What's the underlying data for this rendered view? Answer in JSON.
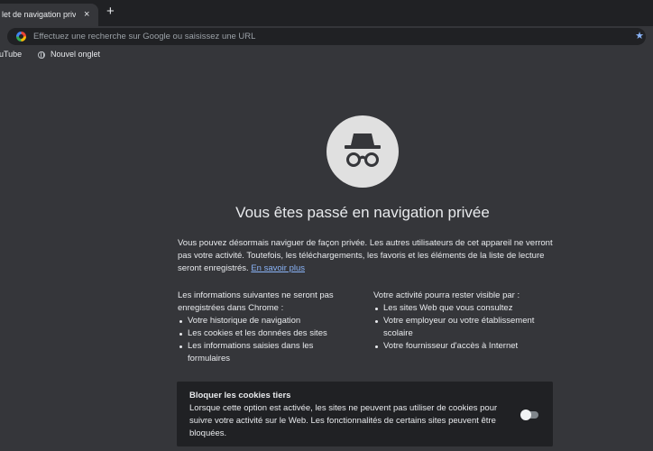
{
  "browser": {
    "tab": {
      "title": "let de navigation privée",
      "close": "×"
    },
    "new_tab": "+",
    "omnibox": {
      "placeholder": "Effectuez une recherche sur Google ou saisissez une URL",
      "star": "★"
    },
    "bookmarks": [
      {
        "label": "uTube"
      },
      {
        "label": "Nouvel onglet"
      }
    ]
  },
  "page": {
    "title": "Vous êtes passé en navigation privée",
    "intro": "Vous pouvez désormais naviguer de façon privée. Les autres utilisateurs de cet appareil ne verront pas votre activité. Toutefois, les téléchargements, les favoris et les éléments de la liste de lecture seront enregistrés.",
    "learn_more": "En savoir plus",
    "not_saved": {
      "heading": "Les informations suivantes ne seront pas enregistrées dans Chrome :",
      "items": [
        "Votre historique de navigation",
        "Les cookies et les données des sites",
        "Les informations saisies dans les formulaires"
      ]
    },
    "visible": {
      "heading": "Votre activité pourra rester visible par :",
      "items": [
        "Les sites Web que vous consultez",
        "Votre employeur ou votre établissement scolaire",
        "Votre fournisseur d'accès à Internet"
      ]
    },
    "cookies": {
      "title": "Bloquer les cookies tiers",
      "description": "Lorsque cette option est activée, les sites ne peuvent pas utiliser de cookies pour suivre votre activité sur le Web. Les fonctionnalités de certains sites peuvent être bloquées.",
      "toggle_on": false
    }
  },
  "colors": {
    "background": "#35363a",
    "tabstrip": "#202124",
    "link": "#8ab4f8",
    "icon_circle": "#e0e0e0"
  }
}
